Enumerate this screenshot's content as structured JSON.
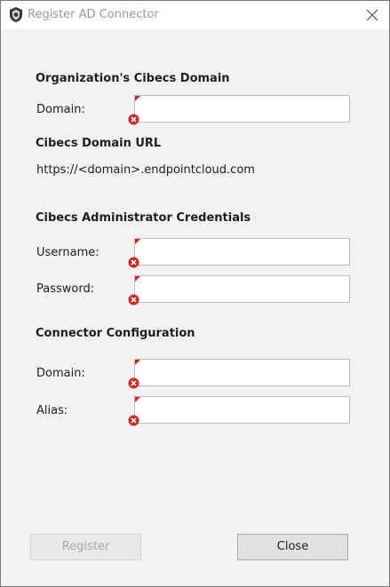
{
  "window": {
    "title": "Register AD Connector"
  },
  "org_section": {
    "title": "Organization's Cibecs Domain",
    "domain_label": "Domain:",
    "domain_value": ""
  },
  "url_section": {
    "title": "Cibecs Domain URL",
    "url_text": "https://<domain>.endpointcloud.com"
  },
  "credentials_section": {
    "title": "Cibecs Administrator Credentials",
    "username_label": "Username:",
    "username_value": "",
    "password_label": "Password:",
    "password_value": ""
  },
  "connector_section": {
    "title": "Connector Configuration",
    "domain_label": "Domain:",
    "domain_value": "",
    "alias_label": "Alias:",
    "alias_value": ""
  },
  "buttons": {
    "register_label": "Register",
    "register_enabled": false,
    "close_label": "Close"
  },
  "colors": {
    "error_red": "#e02020",
    "disabled_text": "#a8a8a8",
    "window_bg": "#f2f2f2"
  }
}
